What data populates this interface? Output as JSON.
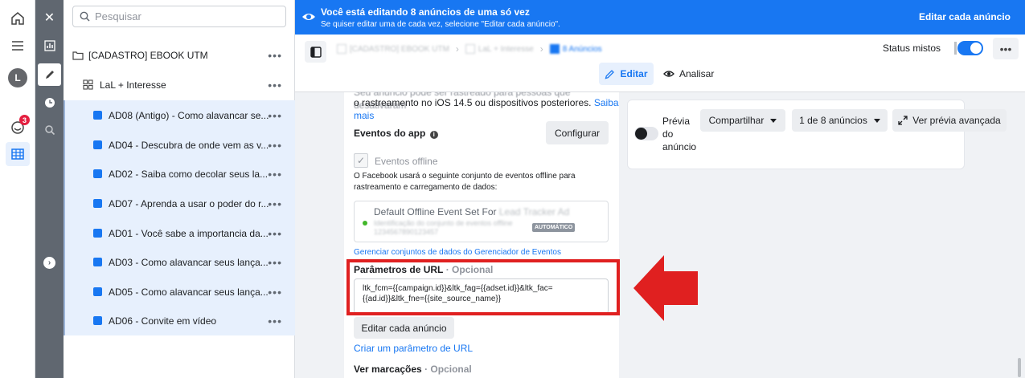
{
  "nav": {
    "user_initial": "L",
    "notif_count": "3"
  },
  "tree": {
    "search_placeholder": "Pesquisar",
    "campaign": "[CADASTRO] EBOOK UTM",
    "adset": "LaL + Interesse",
    "more": "•••",
    "ads": [
      "AD08 (Antigo) - Como alavancar se...",
      "AD04 - Descubra de onde vem as v...",
      "AD02 - Saiba como decolar seus la...",
      "AD07 - Aprenda a usar o poder do r...",
      "AD01 - Você sabe a importancia da...",
      "AD03 - Como alavancar seus lança...",
      "AD05 - Como alavancar seus lança...",
      "AD06 - Convite em vídeo"
    ]
  },
  "banner": {
    "title": "Você está editando 8 anúncios de uma só vez",
    "subtitle": "Se quiser editar uma de cada vez, selecione \"Editar cada anúncio\".",
    "edit_each": "Editar cada anúncio"
  },
  "header": {
    "crumbs": [
      "[CADASTRO] EBOOK UTM",
      "LaL + Interesse",
      "8 Anúncios"
    ],
    "status_label": "Status mistos",
    "more": "•••",
    "tab_edit": "Editar",
    "tab_analyze": "Analisar"
  },
  "form": {
    "intro_line1": "Seu anúncio pode ser rastreado para pessoas que desativaram",
    "intro_line2": "o rastreamento no iOS 14.5 ou dispositivos posteriores.",
    "learn_more_a": "Saiba",
    "learn_more_b": "mais",
    "app_events_label": "Eventos do app",
    "configure": "Configurar",
    "offline_events": "Eventos offline",
    "offline_desc_1": "O Facebook usará o seguinte conjunto de eventos offline para",
    "offline_desc_2": "rastreamento e carregamento de dados:",
    "event_set_name": "Default Offline Event Set For",
    "event_set_owner": "Lead Tracker Ad",
    "event_set_id_label": "Identificação do conjunto de eventos offline",
    "event_set_id": "1234567890123457",
    "auto_badge": "AUTOMÁTICO",
    "manage_link": "Gerenciar conjuntos de dados do Gerenciador de Eventos",
    "url_params_label": "Parâmetros de URL",
    "optional": "· Opcional",
    "url_params_line1": "ltk_fcm={{campaign.id}}&ltk_fag={{adset.id}}&ltk_fac=",
    "url_params_line2": "{{ad.id}}&ltk_fne={{site_source_name}}",
    "edit_each_button": "Editar cada anúncio",
    "create_param_link": "Criar um parâmetro de URL",
    "view_tags_label": "Ver marcações",
    "view_tags_optional": "· Opcional"
  },
  "preview": {
    "label_1": "Prévia",
    "label_2": "do",
    "label_3": "anúncio",
    "share": "Compartilhar",
    "count": "1 de 8 anúncios",
    "advanced": "Ver prévia avançada"
  },
  "colors": {
    "brand_blue": "#1877f2",
    "highlight_red": "#e02020"
  }
}
